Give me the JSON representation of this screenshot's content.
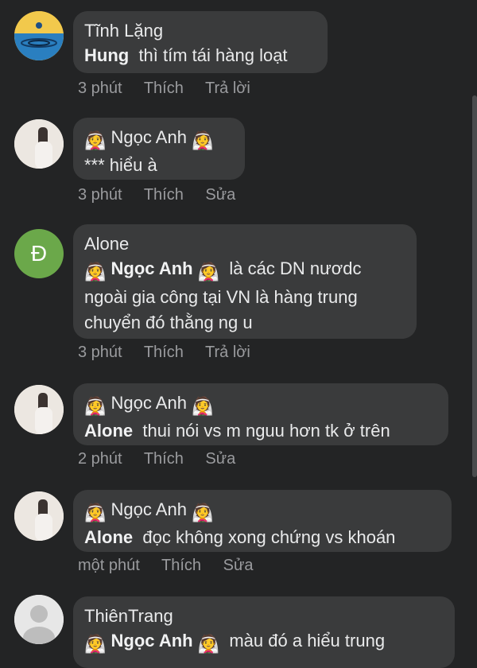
{
  "comments": [
    {
      "author": "Tĩnh Lặng",
      "mention": "Hung",
      "text": "thì tím tái hàng loạt",
      "time": "3 phút",
      "like": "Thích",
      "reply": "Trả lời"
    },
    {
      "author": "Ngọc Anh",
      "mention": "",
      "text": "*** hiểu à",
      "time": "3 phút",
      "like": "Thích",
      "reply": "Sửa"
    },
    {
      "author": "Alone",
      "avatar_letter": "Đ",
      "mention": "Ngọc Anh",
      "text_line1": "là các DN nươdc",
      "text_line2": "ngoài gia công tại VN là hàng trung",
      "text_line3": "chuyển đó thằng ng u",
      "time": "3 phút",
      "like": "Thích",
      "reply": "Trả lời"
    },
    {
      "author": "Ngọc Anh",
      "mention": "Alone",
      "text": "thui nói vs m nguu hơn tk ở trên",
      "time": "2 phút",
      "like": "Thích",
      "reply": "Sửa"
    },
    {
      "author": "Ngọc Anh",
      "mention": "Alone",
      "text": "đọc không xong chứng vs khoán",
      "time": "một phút",
      "like": "Thích",
      "reply": "Sửa"
    },
    {
      "author": "ThiênTrang",
      "mention": "Ngọc Anh",
      "text": "màu đó a hiểu trung"
    }
  ],
  "colors": {
    "background": "#232425",
    "bubble": "#3a3b3c",
    "meta": "#9a9b9e",
    "avatar_green": "#6ba84a"
  }
}
